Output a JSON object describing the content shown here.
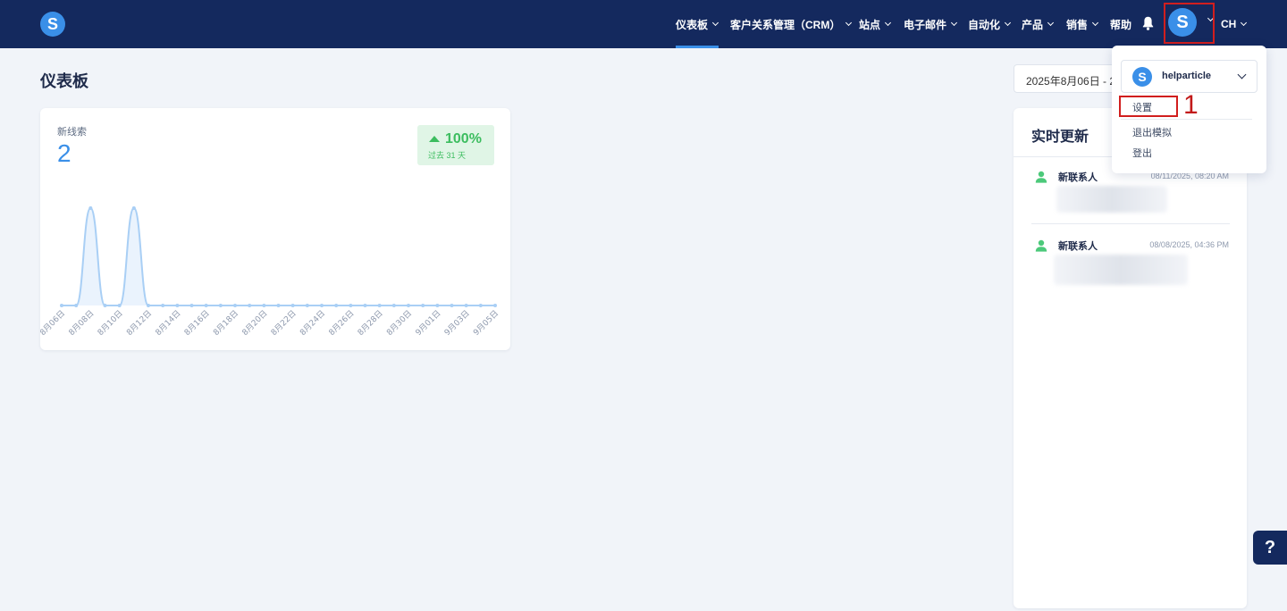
{
  "header": {
    "logo_letter": "S",
    "nav": [
      {
        "label": "仪表板",
        "has_dropdown": true,
        "active": true
      },
      {
        "label": "客户关系管理（CRM）",
        "has_dropdown": true
      },
      {
        "label": "站点",
        "has_dropdown": true
      },
      {
        "label": "电子邮件",
        "has_dropdown": true
      },
      {
        "label": "自动化",
        "has_dropdown": true
      },
      {
        "label": "产品",
        "has_dropdown": true
      },
      {
        "label": "销售",
        "has_dropdown": true
      },
      {
        "label": "帮助",
        "has_dropdown": false
      }
    ],
    "bell_icon": "bell-icon",
    "avatar_letter": "S",
    "language": "CH"
  },
  "page": {
    "title": "仪表板",
    "date_range": "2025年8月06日 - 2025年9月05日"
  },
  "leads_card": {
    "label": "新线索",
    "value": "2",
    "trend": "100%",
    "trend_direction": "up",
    "trend_period": "过去 31 天"
  },
  "chart_data": {
    "type": "area",
    "x_tick_labels": [
      "8月06日",
      "8月08日",
      "8月10日",
      "8月12日",
      "8月14日",
      "8月16日",
      "8月18日",
      "8月20日",
      "8月22日",
      "8月24日",
      "8月26日",
      "8月28日",
      "8月30日",
      "9月01日",
      "9月03日",
      "9月05日"
    ],
    "values": [
      0,
      0,
      1,
      0,
      0,
      1,
      0,
      0,
      0,
      0,
      0,
      0,
      0,
      0,
      0,
      0,
      0,
      0,
      0,
      0,
      0,
      0,
      0,
      0,
      0,
      0,
      0,
      0,
      0,
      0,
      0
    ],
    "grid": false,
    "colors": {
      "line": "#a9cff5",
      "fill": "#eaf3fd"
    }
  },
  "live_updates": {
    "title": "实时更新",
    "items": [
      {
        "icon": "person-icon",
        "title": "新联系人",
        "time": "08/11/2025, 08:20 AM"
      },
      {
        "icon": "person-icon",
        "title": "新联系人",
        "time": "08/08/2025, 04:36 PM"
      }
    ]
  },
  "account_menu": {
    "account_letter": "S",
    "account_name": "helparticle",
    "items": [
      "设置",
      "退出模拟",
      "登出"
    ]
  },
  "annotation": {
    "step_number": "1",
    "color": "#d11e1e"
  },
  "help_button": {
    "label": "?"
  }
}
